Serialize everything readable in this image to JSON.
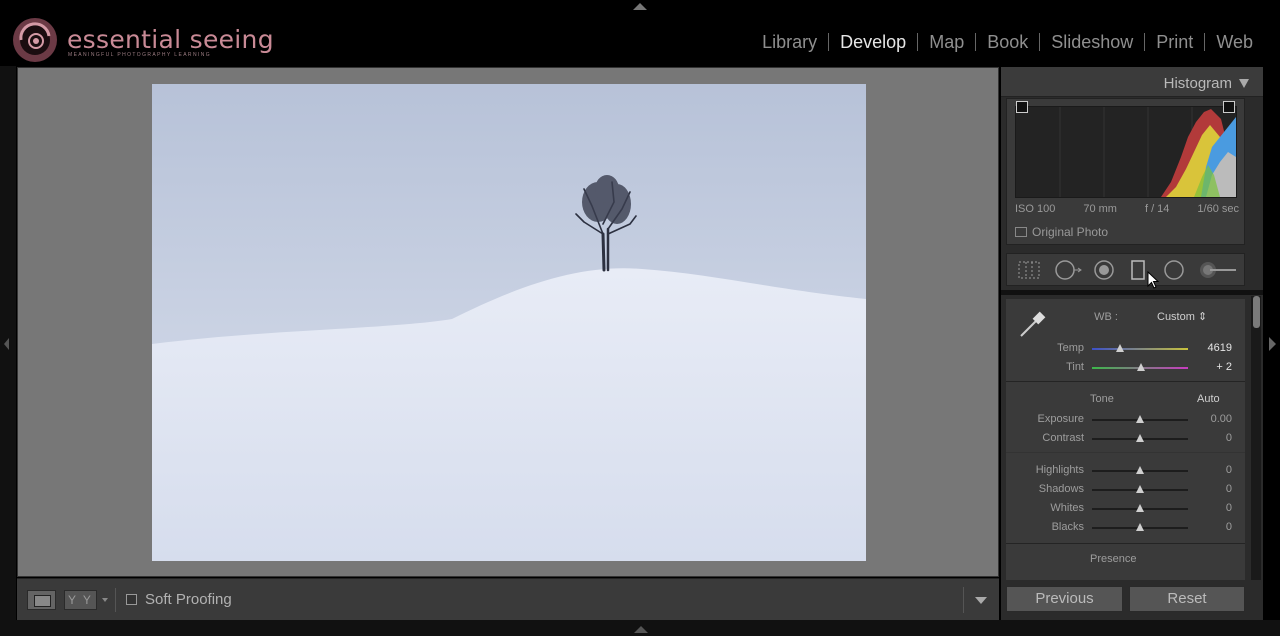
{
  "brand": {
    "name": "essential seeing",
    "tagline": "MEANINGFUL PHOTOGRAPHY LEARNING"
  },
  "modules": [
    {
      "label": "Library",
      "active": false
    },
    {
      "label": "Develop",
      "active": true
    },
    {
      "label": "Map",
      "active": false
    },
    {
      "label": "Book",
      "active": false
    },
    {
      "label": "Slideshow",
      "active": false
    },
    {
      "label": "Print",
      "active": false
    },
    {
      "label": "Web",
      "active": false
    }
  ],
  "histogram": {
    "title": "Histogram",
    "exif": {
      "iso": "ISO 100",
      "focal": "70 mm",
      "aperture": "f / 14",
      "shutter": "1/60 sec"
    },
    "original_photo_label": "Original Photo"
  },
  "basic": {
    "wb_label": "WB :",
    "wb_value": "Custom",
    "temp": {
      "label": "Temp",
      "value": "4619"
    },
    "tint": {
      "label": "Tint",
      "value": "+ 2"
    },
    "tone_title": "Tone",
    "auto_label": "Auto",
    "exposure": {
      "label": "Exposure",
      "value": "0.00"
    },
    "contrast": {
      "label": "Contrast",
      "value": "0"
    },
    "highlights": {
      "label": "Highlights",
      "value": "0"
    },
    "shadows": {
      "label": "Shadows",
      "value": "0"
    },
    "whites": {
      "label": "Whites",
      "value": "0"
    },
    "blacks": {
      "label": "Blacks",
      "value": "0"
    },
    "presence_title": "Presence"
  },
  "toolbar": {
    "soft_proofing": "Soft Proofing",
    "yy_label": "Y Y"
  },
  "buttons": {
    "previous": "Previous",
    "reset": "Reset"
  },
  "colors": {
    "accent_brand": "#c98a96",
    "panel": "#3a3a3a",
    "background": "#000000"
  }
}
